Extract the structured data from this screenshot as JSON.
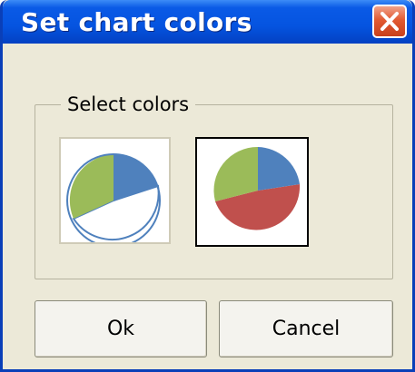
{
  "dialog": {
    "title": "Set chart colors",
    "close_icon": "close-x-icon"
  },
  "group": {
    "label": "Select colors"
  },
  "options": [
    {
      "name": "pie-option-outline",
      "colors": {
        "slice_a": "#4f81bd",
        "slice_b": "#9bbb59",
        "slice_c": "#ffffff"
      }
    },
    {
      "name": "pie-option-filled",
      "colors": {
        "slice_a": "#4f81bd",
        "slice_b": "#9bbb59",
        "slice_c": "#c0504d"
      }
    }
  ],
  "buttons": {
    "ok": "Ok",
    "cancel": "Cancel"
  },
  "colors": {
    "titlebar": "#0554e0",
    "window_bg": "#ece9d8",
    "close_button": "#e25a32"
  }
}
